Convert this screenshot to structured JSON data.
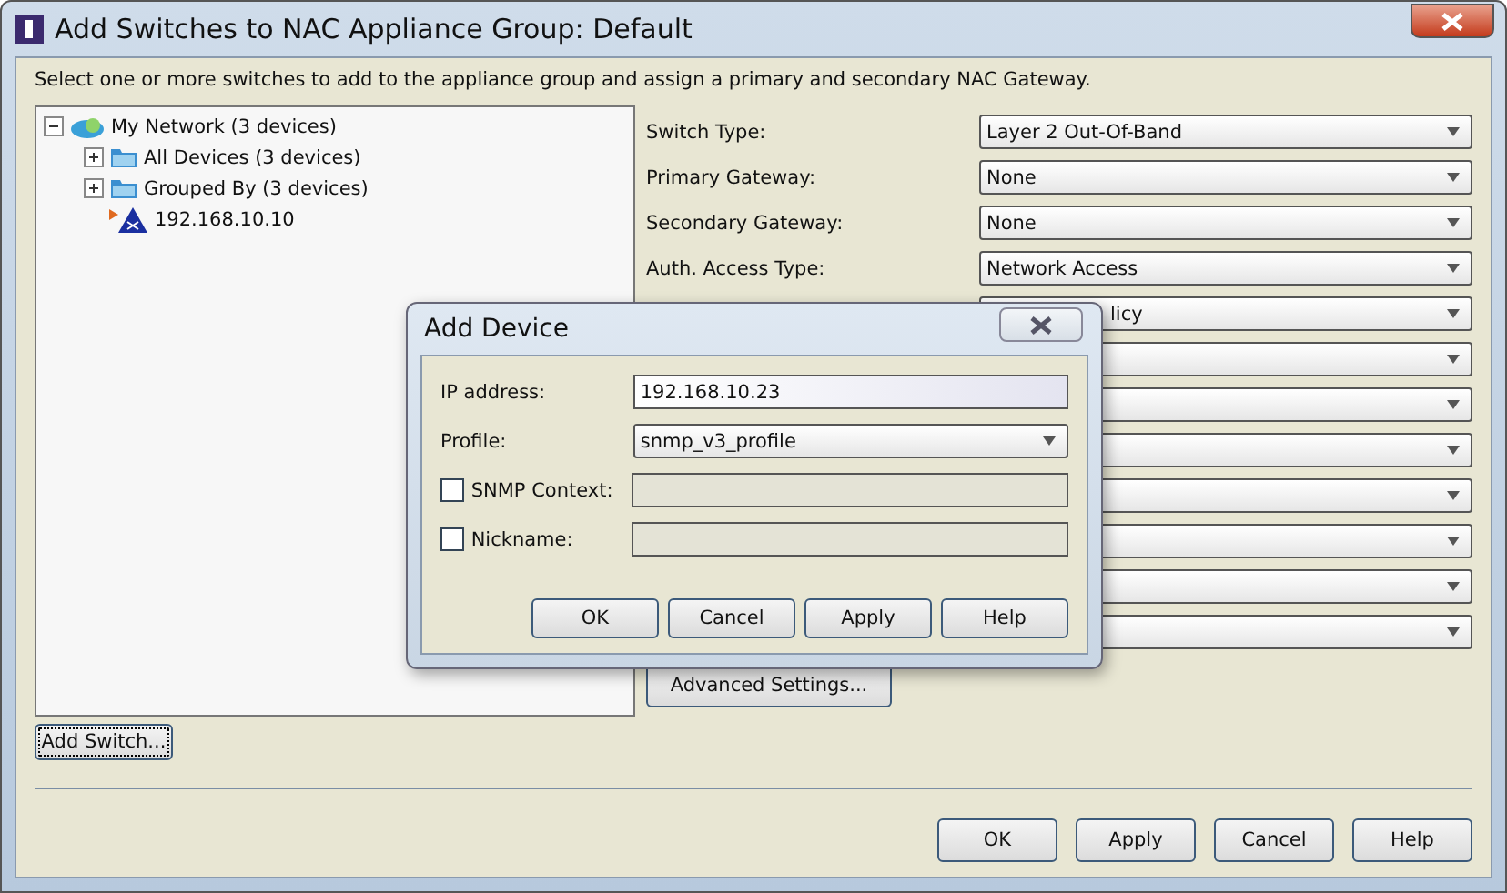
{
  "window": {
    "title": "Add Switches to NAC Appliance Group: Default"
  },
  "instruction": "Select one or more switches to add to the appliance group and assign a primary and secondary NAC Gateway.",
  "tree": [
    {
      "label": "My Network (3 devices)",
      "kind": "network",
      "expanded": true,
      "children": [
        {
          "label": "All Devices (3 devices)",
          "kind": "folder",
          "expanded": false
        },
        {
          "label": "Grouped By (3 devices)",
          "kind": "folder",
          "expanded": false
        },
        {
          "label": "192.168.10.10",
          "kind": "device"
        }
      ]
    }
  ],
  "add_switch_button": "Add Switch...",
  "settings": [
    {
      "kind": "combo",
      "label": "Switch Type:",
      "value": "Layer 2 Out-Of-Band"
    },
    {
      "kind": "combo",
      "label": "Primary Gateway:",
      "value": "None"
    },
    {
      "kind": "combo",
      "label": "Secondary Gateway:",
      "value": "None"
    },
    {
      "kind": "combo",
      "label": "Auth. Access Type:",
      "value": "Network Access"
    },
    {
      "kind": "covered",
      "value": "licy"
    },
    {
      "kind": "covered"
    },
    {
      "kind": "covered"
    },
    {
      "kind": "covered"
    },
    {
      "kind": "covered"
    },
    {
      "kind": "covered"
    },
    {
      "kind": "covered"
    },
    {
      "kind": "covered"
    }
  ],
  "advanced_button": "Advanced Settings...",
  "buttons": [
    "OK",
    "Apply",
    "Cancel",
    "Help"
  ],
  "dialog": {
    "title": "Add Device",
    "fields": [
      {
        "kind": "text",
        "label": "IP address:",
        "value": "192.168.10.23"
      },
      {
        "kind": "combo",
        "label": "Profile:",
        "value": "snmp_v3_profile"
      },
      {
        "kind": "check",
        "label": "SNMP Context:",
        "checked": false
      },
      {
        "kind": "check",
        "label": "Nickname:",
        "checked": false
      }
    ],
    "buttons": [
      "OK",
      "Cancel",
      "Apply",
      "Help"
    ]
  }
}
